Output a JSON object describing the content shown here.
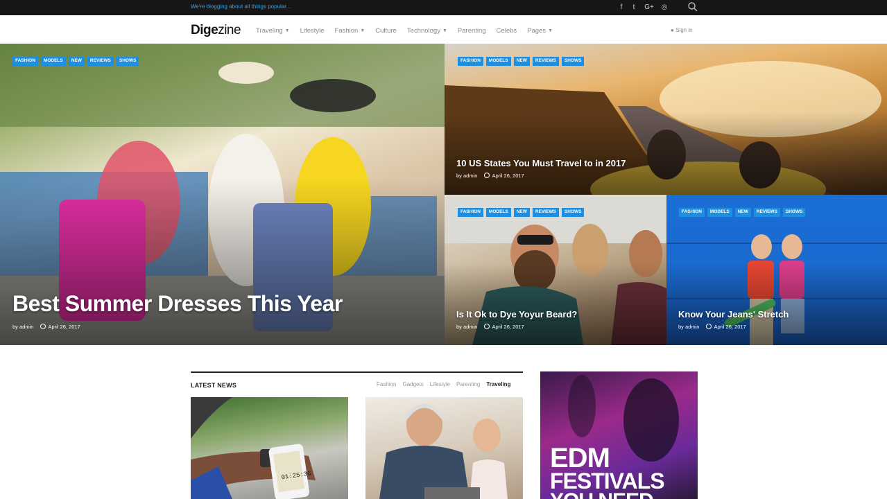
{
  "topbar": {
    "tagline": "We're blogging about all things popular...",
    "social_icons": [
      "facebook-icon",
      "twitter-icon",
      "google-plus-icon",
      "instagram-icon"
    ],
    "social_glyphs": [
      "f",
      "t",
      "G+",
      "◎"
    ]
  },
  "header": {
    "logo_bold": "Dige",
    "logo_light": "zine",
    "nav": [
      {
        "label": "Traveling",
        "dropdown": true
      },
      {
        "label": "Lifestyle",
        "dropdown": false
      },
      {
        "label": "Fashion",
        "dropdown": true
      },
      {
        "label": "Culture",
        "dropdown": false
      },
      {
        "label": "Technology",
        "dropdown": true
      },
      {
        "label": "Parenting",
        "dropdown": false
      },
      {
        "label": "Celebs",
        "dropdown": false
      },
      {
        "label": "Pages",
        "dropdown": true
      }
    ],
    "signin": "Sign in"
  },
  "hero": {
    "tags": [
      "FASHION",
      "MODELS",
      "NEW",
      "REVIEWS",
      "SHOWS"
    ],
    "tiles": [
      {
        "title": "Best Summer Dresses This Year",
        "author": "by admin",
        "date": "April 26, 2017"
      },
      {
        "title": "10 US States You Must Travel to in 2017",
        "author": "by admin",
        "date": "April 26, 2017"
      },
      {
        "title": "Is It Ok to Dye Yoyur Beard?",
        "author": "by admin",
        "date": "April 26, 2017"
      },
      {
        "title": "Know Your Jeans' Stretch",
        "author": "by admin",
        "date": "April 26, 2017"
      }
    ]
  },
  "latest_news": {
    "title": "LATEST NEWS",
    "tabs": [
      "Fashion",
      "Gadgets",
      "Lifestyle",
      "Parenting",
      "Traveling"
    ],
    "active_tab": "Traveling",
    "watch_time": "01:25:36"
  },
  "ad": {
    "line1": "EDM",
    "line2": "FESTIVALS",
    "line3": "YOU NEED"
  },
  "colors": {
    "accent": "#1e8fe0",
    "topbar_bg": "#161616",
    "tagline": "#38a6e8"
  }
}
